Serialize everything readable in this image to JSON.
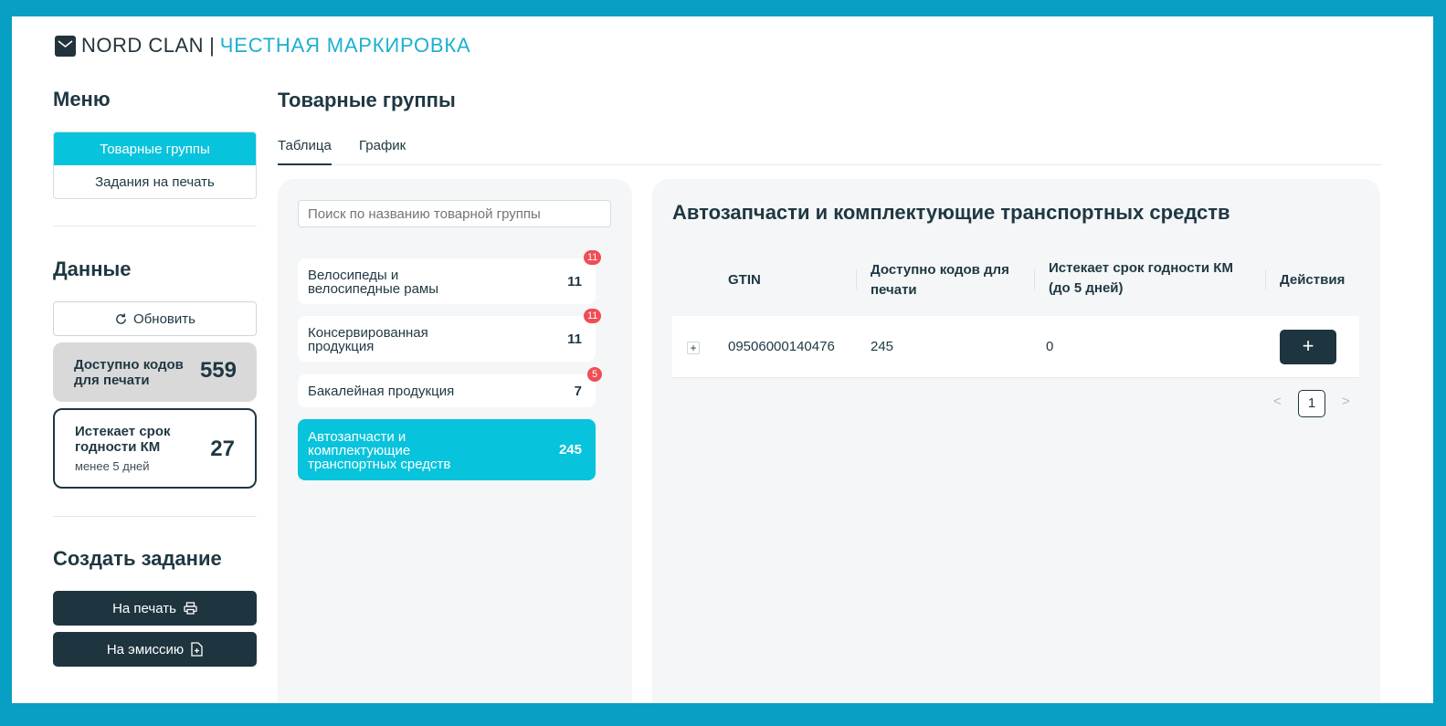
{
  "brand": {
    "name": "NORD CLAN",
    "separator": "|",
    "product": "ЧЕСТНАЯ МАРКИРОВКА",
    "accent_color": "#1cb0cf"
  },
  "sidebar": {
    "menu_title": "Меню",
    "menu_items": [
      {
        "label": "Товарные группы",
        "active": true
      },
      {
        "label": "Задания на печать",
        "active": false
      }
    ],
    "data_title": "Данные",
    "refresh_label": "Обновить",
    "available": {
      "label": "Доступно кодов для печати",
      "value": "559"
    },
    "expiring": {
      "label": "Истекает срок годности КМ",
      "sub": "менее 5 дней",
      "value": "27"
    },
    "create_title": "Создать задание",
    "print_button": "На печать",
    "emission_button": "На эмиссию"
  },
  "main": {
    "title": "Товарные группы",
    "tabs": [
      {
        "label": "Таблица",
        "active": true
      },
      {
        "label": "График",
        "active": false
      }
    ],
    "search_placeholder": "Поиск по названию товарной группы",
    "groups": [
      {
        "name_lines": [
          "Велосипеды и",
          "велосипедные рамы"
        ],
        "count": "11",
        "badge": "11",
        "active": false
      },
      {
        "name_lines": [
          "Консервированная",
          "продукция"
        ],
        "count": "11",
        "badge": "11",
        "active": false
      },
      {
        "name_lines": [
          "Бакалейная продукция"
        ],
        "count": "7",
        "badge": "5",
        "active": false
      },
      {
        "name_lines": [
          "Автозапчасти и",
          "комплектующие",
          "транспортных средств"
        ],
        "count": "245",
        "badge": "",
        "active": true
      }
    ]
  },
  "detail": {
    "title": "Автозапчасти и комплектующие транспортных средств",
    "columns": {
      "gtin": "GTIN",
      "available_1": "Доступно кодов для",
      "available_2": "печати",
      "expiring_1": "Истекает срок годности КМ",
      "expiring_2": "(до 5 дней)",
      "actions": "Действия"
    },
    "rows": [
      {
        "expand": "+",
        "gtin": "09506000140476",
        "available": "245",
        "expiring": "0",
        "action": "+"
      }
    ],
    "pagination": {
      "prev": "<",
      "current": "1",
      "next": ">"
    }
  },
  "colors": {
    "frame_border": "#079fc3",
    "active_cyan": "#08c3dc",
    "dark_button": "#1e3540",
    "badge_red": "#f04d55"
  }
}
